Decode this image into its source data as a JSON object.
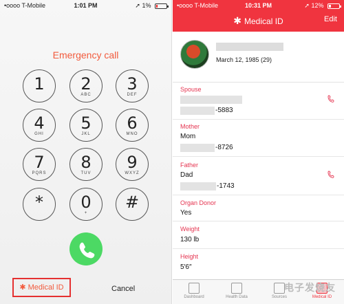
{
  "left": {
    "status": {
      "carrier": "•oooo T-Mobile",
      "time": "1:01 PM",
      "battery": "1%"
    },
    "title": "Emergency call",
    "keys": [
      {
        "digit": "1",
        "letters": ""
      },
      {
        "digit": "2",
        "letters": "ABC"
      },
      {
        "digit": "3",
        "letters": "DEF"
      },
      {
        "digit": "4",
        "letters": "GHI"
      },
      {
        "digit": "5",
        "letters": "JKL"
      },
      {
        "digit": "6",
        "letters": "MNO"
      },
      {
        "digit": "7",
        "letters": "PQRS"
      },
      {
        "digit": "8",
        "letters": "TUV"
      },
      {
        "digit": "9",
        "letters": "WXYZ"
      },
      {
        "digit": "*",
        "letters": ""
      },
      {
        "digit": "0",
        "letters": "+"
      },
      {
        "digit": "#",
        "letters": ""
      }
    ],
    "medical_id": "✱ Medical ID",
    "cancel": "Cancel",
    "call_color": "#4cd964"
  },
  "right": {
    "status": {
      "carrier": "•oooo T-Mobile",
      "time": "10:31 PM",
      "battery": "12%"
    },
    "title_star": "✱",
    "title": "Medical ID",
    "edit": "Edit",
    "dob": "March 12, 1985 (29)",
    "fields": {
      "spouse": {
        "label": "Spouse",
        "phone": "-5883"
      },
      "mother": {
        "label": "Mother",
        "name": "Mom",
        "phone": "-8726"
      },
      "father": {
        "label": "Father",
        "name": "Dad",
        "phone": "-1743"
      },
      "organ": {
        "label": "Organ Donor",
        "value": "Yes"
      },
      "weight": {
        "label": "Weight",
        "value": "130 lb"
      },
      "height": {
        "label": "Height",
        "value": "5′6″"
      }
    },
    "tabs": [
      "Dashboard",
      "Health Data",
      "Sources",
      "Medical ID"
    ],
    "accent": "#f0343f"
  },
  "watermark": "电子发烧友"
}
